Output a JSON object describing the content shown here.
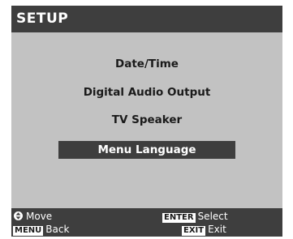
{
  "header": {
    "title": "SETUP"
  },
  "menu": {
    "items": [
      {
        "label": "Date/Time"
      },
      {
        "label": "Digital Audio Output"
      },
      {
        "label": "TV Speaker"
      },
      {
        "label": "Menu Language",
        "selected": true
      }
    ]
  },
  "footer": {
    "move_label": "Move",
    "menu_key": "MENU",
    "back_label": "Back",
    "enter_key": "ENTER",
    "select_label": "Select",
    "exit_key": "EXIT",
    "exit_label": "Exit"
  },
  "colors": {
    "panel_background": "#c2c2c2",
    "bar_background": "#3e3e3e",
    "highlight_background": "#3e3e3e",
    "text_dark": "#1a1a1a",
    "text_light": "#ffffff"
  },
  "icons": {
    "move": "up-down-arrows-icon"
  }
}
